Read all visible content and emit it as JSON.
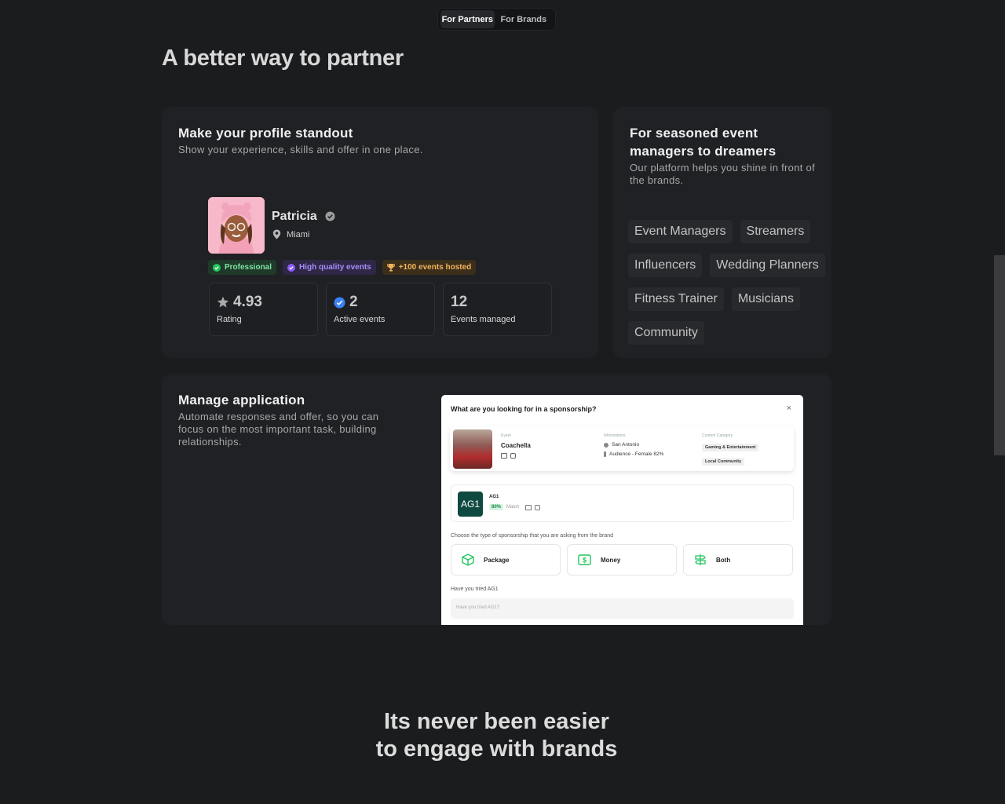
{
  "toggle": {
    "partners": "For Partners",
    "brands": "For Brands"
  },
  "main_title": "A better way to partner",
  "profile_card": {
    "title": "Make your profile standout",
    "subtitle": "Show your experience, skills and offer in one place.",
    "name": "Patricia",
    "location": "Miami",
    "badges": [
      "Professional",
      "High quality events",
      "+100 events hosted"
    ],
    "stats": [
      {
        "value": "4.93",
        "label": "Rating"
      },
      {
        "value": "2",
        "label": "Active events"
      },
      {
        "value": "12",
        "label": "Events managed"
      }
    ]
  },
  "seasoned_card": {
    "title": "For seasoned event managers to dreamers",
    "subtitle": "Our platform helps you shine in front of the brands.",
    "tags": [
      "Event Managers",
      "Streamers",
      "Influencers",
      "Wedding Planners",
      "Fitness Trainer",
      "Musicians",
      "Community"
    ]
  },
  "manage_card": {
    "title": "Manage application",
    "subtitle": "Automate responses and offer, so you can focus on the most important task, building relationships."
  },
  "mock": {
    "title": "What are you looking for in a sponsorship?",
    "close": "×",
    "event_label": "Event",
    "event_name": "Coachella",
    "info_label": "Informations",
    "info_city": "San Antonio",
    "info_audience": "Audience - Female 82%",
    "category_label": "Content Category",
    "categories": [
      "Gaming & Entertainment",
      "Local Community"
    ],
    "brand_logo": "AG1",
    "brand_name": "AG1",
    "match_pct": "80%",
    "match_label": "Match",
    "choose_label": "Choose the type of sponsorship that you are asking from the brand",
    "options": [
      "Package",
      "Money",
      "Both"
    ],
    "question_label": "Have you tried AG1",
    "question_placeholder": "Have you tried AG1?"
  },
  "bottom_title": {
    "line1": "Its never been easier",
    "line2": "to engage with brands"
  },
  "colors": {
    "background": "#1b1c1e",
    "card": "#202124",
    "green": "#22c55e",
    "purple": "#a78bfa",
    "orange": "#f2b35c",
    "blue": "#3b82f6"
  }
}
